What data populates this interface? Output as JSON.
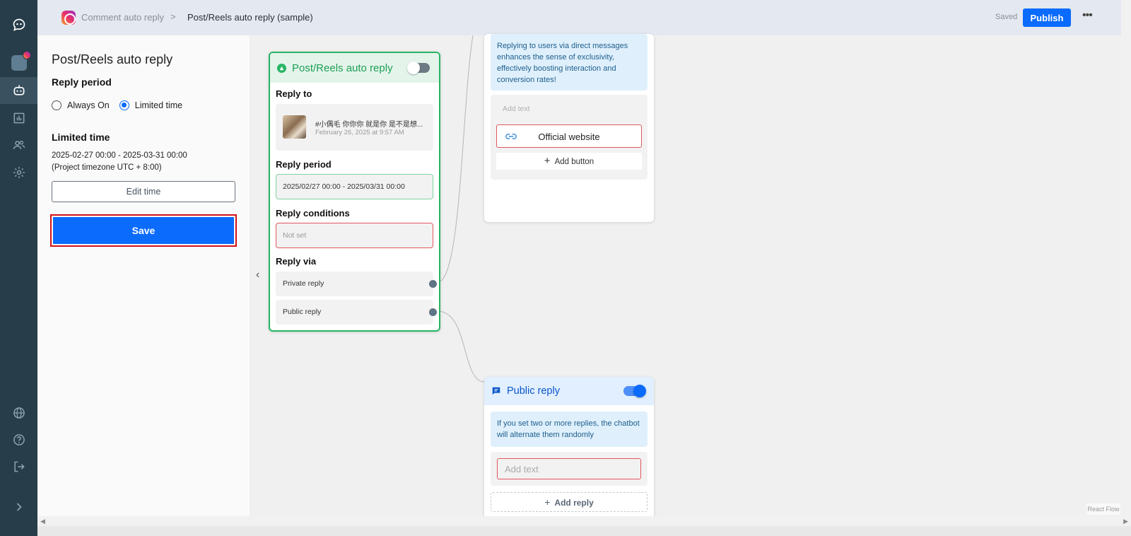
{
  "topbar": {
    "breadcrumb_parent": "Comment auto reply",
    "breadcrumb_sep": ">",
    "breadcrumb_current": "Post/Reels auto reply (sample)",
    "status": "Saved",
    "publish_label": "Publish",
    "more_label": "•••"
  },
  "panel": {
    "title": "Post/Reels auto reply",
    "reply_period_title": "Reply period",
    "option_always": "Always On",
    "option_limited": "Limited time",
    "selected_option": "Limited time",
    "limited_title": "Limited time",
    "limited_range": "2025-02-27 00:00 - 2025-03-31 00:00",
    "timezone": "(Project timezone UTC + 8:00)",
    "edit_time_label": "Edit time",
    "save_label": "Save",
    "collapse_label": "‹"
  },
  "main_node": {
    "title": "Post/Reels auto reply",
    "enabled": false,
    "reply_to_label": "Reply to",
    "post_title": "#小偶毛 你你你 就是你 是不是想...",
    "post_date": "February 26, 2025 at 9:57 AM",
    "reply_period_label": "Reply period",
    "reply_period_value": "2025/02/27 00:00 - 2025/03/31 00:00",
    "reply_conditions_label": "Reply conditions",
    "reply_conditions_value": "Not set",
    "reply_via_label": "Reply via",
    "via_private": "Private reply",
    "via_public": "Public reply"
  },
  "dm_node": {
    "info": "Replying to users via direct messages enhances the sense of exclusivity, effectively boosting interaction and conversion rates!",
    "add_text_placeholder": "Add text",
    "button_label": "Official website",
    "add_button_label": "Add button"
  },
  "public_node": {
    "title": "Public reply",
    "enabled": true,
    "info": "If you set two or more replies, the chatbot will alternate them randomly",
    "add_text_placeholder": "Add text",
    "add_reply_label": "Add reply"
  },
  "canvas": {
    "attribution": "React Flow"
  },
  "colors": {
    "accent_blue": "#0b6bfd",
    "node_green": "#27b564",
    "error_red": "#e0585e",
    "rail_bg": "#273d49"
  }
}
